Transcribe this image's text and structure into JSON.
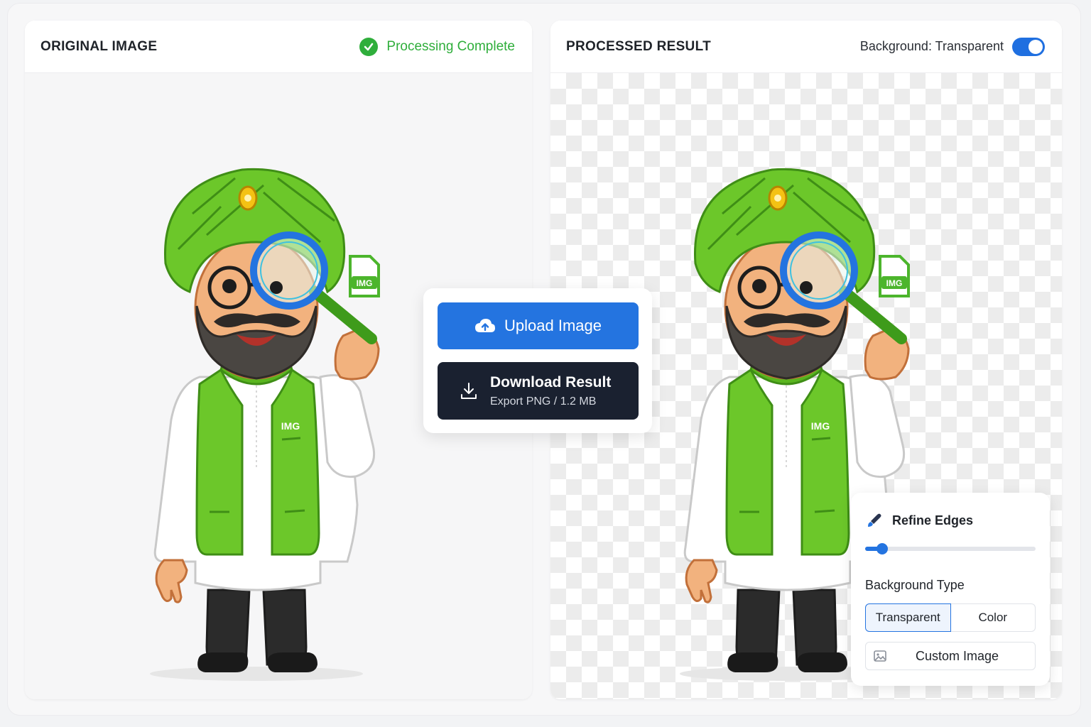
{
  "left_panel": {
    "title": "ORIGINAL IMAGE",
    "status": "Processing Complete",
    "status_icon": "check-circle-icon"
  },
  "right_panel": {
    "title": "PROCESSED RESULT",
    "background_toggle_label": "Background: Transparent",
    "background_toggle_on": true
  },
  "figure": {
    "badge_text": "IMG",
    "vest_text": "IMG"
  },
  "actions": {
    "upload_label": "Upload Image",
    "upload_icon": "cloud-upload-icon",
    "download_label": "Download Result",
    "download_sub": "Export PNG / 1.2 MB",
    "download_icon": "download-icon"
  },
  "refine": {
    "title": "Refine Edges",
    "title_icon": "brush-icon",
    "slider_value": 0.1,
    "background_type_label": "Background Type",
    "options": [
      "Transparent",
      "Color"
    ],
    "selected_option": "Transparent",
    "custom_image_label": "Custom Image",
    "custom_image_icon": "image-icon"
  },
  "colors": {
    "accent": "#2474e0",
    "success": "#2fae3b",
    "dark_button": "#1a2130",
    "turban_green": "#6cc72a"
  }
}
